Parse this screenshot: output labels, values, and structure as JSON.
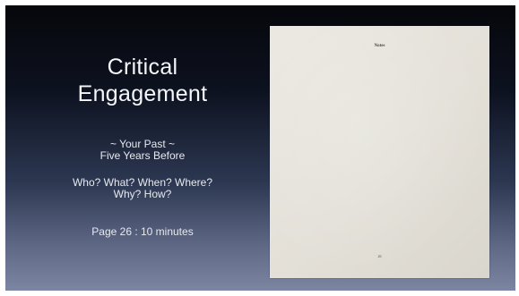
{
  "slide": {
    "title": [
      "Critical",
      "Engagement"
    ],
    "past": [
      "~ Your Past ~",
      "Five Years Before"
    ],
    "questions": [
      "Who? What? When? Where?",
      "Why? How?"
    ],
    "timing": "Page 26 : 10 minutes"
  },
  "notes_page": {
    "heading": "Notes",
    "page_number": "26"
  },
  "colors": {
    "background_top": "#06070b",
    "background_bottom": "#7c86a3",
    "text": "#eef0f5",
    "paper": "#e6e3db"
  }
}
